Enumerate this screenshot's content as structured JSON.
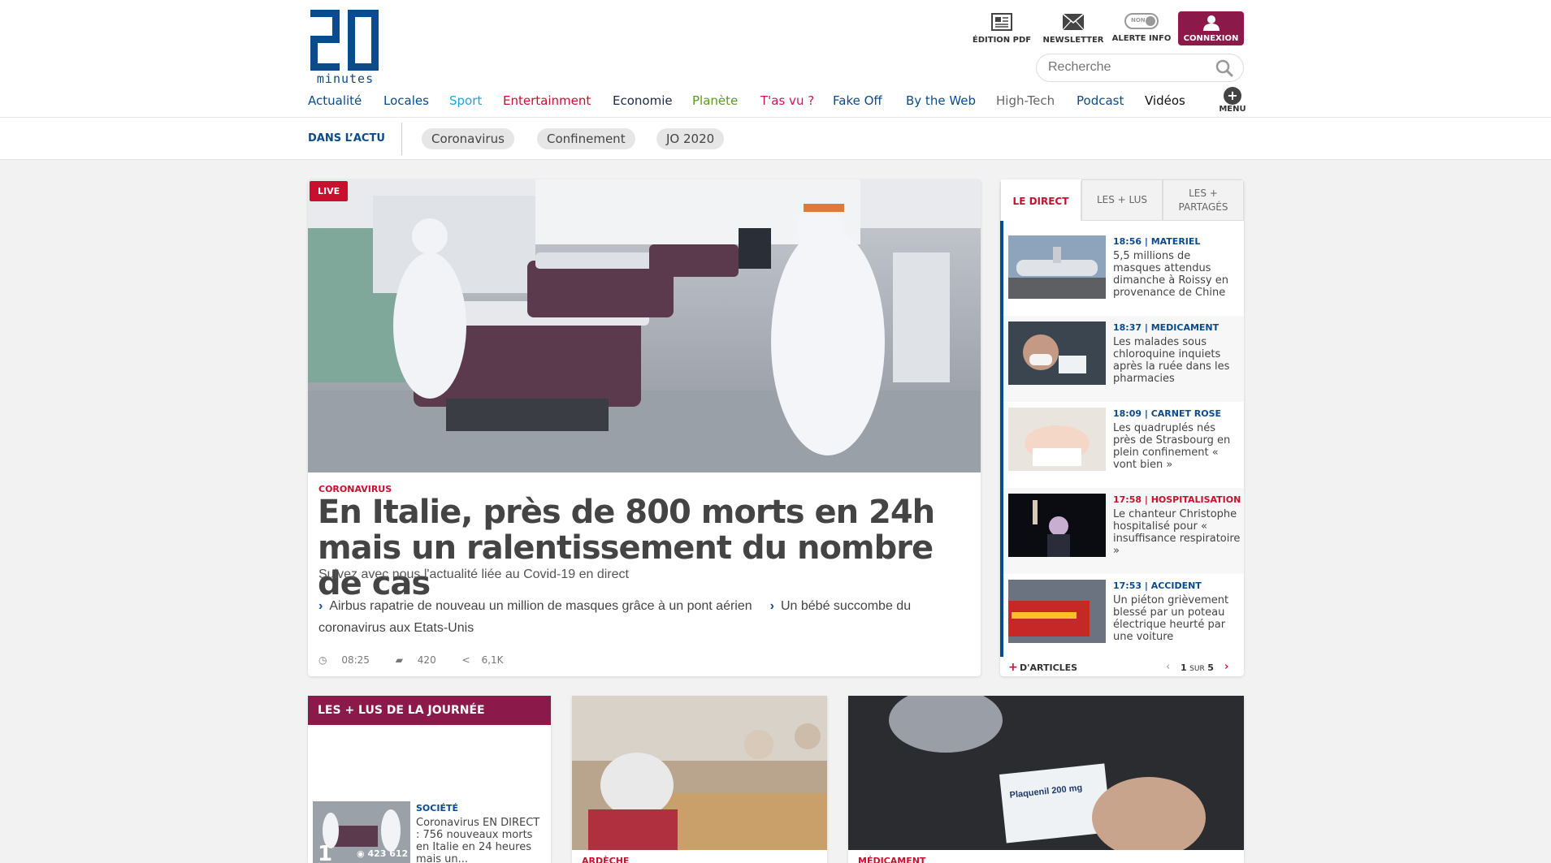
{
  "header": {
    "logo_number": "20",
    "logo_word": "minutes",
    "tools": {
      "pdf": "ÉDITION PDF",
      "newsletter": "NEWSLETTER",
      "alert": "ALERTE INFO",
      "alert_toggle": "NON",
      "login": "CONNEXION"
    },
    "search_placeholder": "Recherche",
    "nav": [
      {
        "label": "Actualité",
        "color": "#0b4a8b"
      },
      {
        "label": "Locales",
        "color": "#0b4a8b"
      },
      {
        "label": "Sport",
        "color": "#1fa3d6"
      },
      {
        "label": "Entertainment",
        "color": "#c8102e"
      },
      {
        "label": "Economie",
        "color": "#1b2a4a"
      },
      {
        "label": "Planète",
        "color": "#5a9a1f"
      },
      {
        "label": "T'as vu ?",
        "color": "#c2185b"
      },
      {
        "label": "Fake Off",
        "color": "#0b4a8b"
      },
      {
        "label": "By the Web",
        "color": "#0b4a8b"
      },
      {
        "label": "High-Tech",
        "color": "#666666"
      },
      {
        "label": "Podcast",
        "color": "#0b4a8b"
      },
      {
        "label": "Vidéos",
        "color": "#111111"
      }
    ],
    "menu_label": "MENU",
    "actu_label": "DANS L’ACTU",
    "chips": [
      "Coronavirus",
      "Confinement",
      "JO 2020"
    ]
  },
  "main": {
    "live": "LIVE",
    "rubric": "CORONAVIRUS",
    "headline": "En Italie, près de 800 morts en 24h mais un ralentissement du nombre de cas",
    "dek": "Suivez avec nous l'actualité liée au Covid-19 en direct",
    "related": [
      "Airbus rapatrie de nouveau un million de masques grâce à un pont aérien",
      "Un bébé succombe du coronavirus aux Etats-Unis"
    ],
    "time": "08:25",
    "comments": "420",
    "shares": "6,1K"
  },
  "sidebar": {
    "tabs": [
      "LE DIRECT",
      "LES + LUS",
      "LES + PARTAGÉS"
    ],
    "items": [
      {
        "tag": "18:56 | MATERIEL",
        "tag_color": "#0b4a8b",
        "title": "5,5 millions de masques attendus dimanche à Roissy en provenance de Chine"
      },
      {
        "tag": "18:37 | MEDICAMENT",
        "tag_color": "#0b4a8b",
        "title": "Les malades sous chloroquine inquiets après la ruée dans les pharmacies"
      },
      {
        "tag": "18:09 | CARNET ROSE",
        "tag_color": "#0b4a8b",
        "title": "Les quadruplés nés près de Strasbourg en plein confinement « vont bien »"
      },
      {
        "tag": "17:58 | HOSPITALISATION",
        "tag_color": "#c8102e",
        "title": "Le chanteur Christophe hospitalisé pour « insuffisance respiratoire »"
      },
      {
        "tag": "17:53 | ACCIDENT",
        "tag_color": "#0b4a8b",
        "title": "Un piéton grièvement blessé par un poteau électrique heurté par une voiture"
      }
    ],
    "more": "D'ARTICLES",
    "page_current": "1",
    "page_sep": "SUR",
    "page_total": "5"
  },
  "bottom": {
    "plus_lus_title": "LES + LUS DE LA JOURNÉE",
    "rank": "1",
    "rank_views": "423 612",
    "rank_tag": "SOCIÉTÉ",
    "rank_title": "Coronavirus EN DIRECT : 756 nouveaux morts en Italie en 24 heures mais un...",
    "card2_tag": "ARDÈCHE",
    "card3_tag": "MÉDICAMENT",
    "card3_box_label": "Plaquenil 200 mg"
  }
}
